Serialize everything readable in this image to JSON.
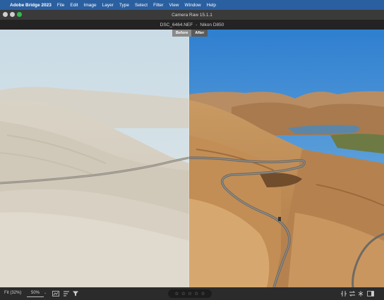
{
  "menubar": {
    "app_name": "Adobe Bridge 2023",
    "items": [
      "File",
      "Edit",
      "Image",
      "Layer",
      "Type",
      "Select",
      "Filter",
      "View",
      "Window",
      "Help"
    ]
  },
  "window": {
    "title": "Camera Raw 15.1.1"
  },
  "file_info": {
    "filename": "DSC_6464.NEF",
    "separator": "-",
    "camera": "Nikon D850"
  },
  "compare": {
    "before_label": "Before",
    "after_label": "After"
  },
  "bottom": {
    "fit_label": "Fit (32%)",
    "zoom_value": "50%",
    "stars": [
      "☆",
      "☆",
      "☆",
      "☆",
      "☆"
    ]
  },
  "colors": {
    "menubar_bg": "#2a5fa0",
    "traffic_max": "#2fbf4a"
  }
}
